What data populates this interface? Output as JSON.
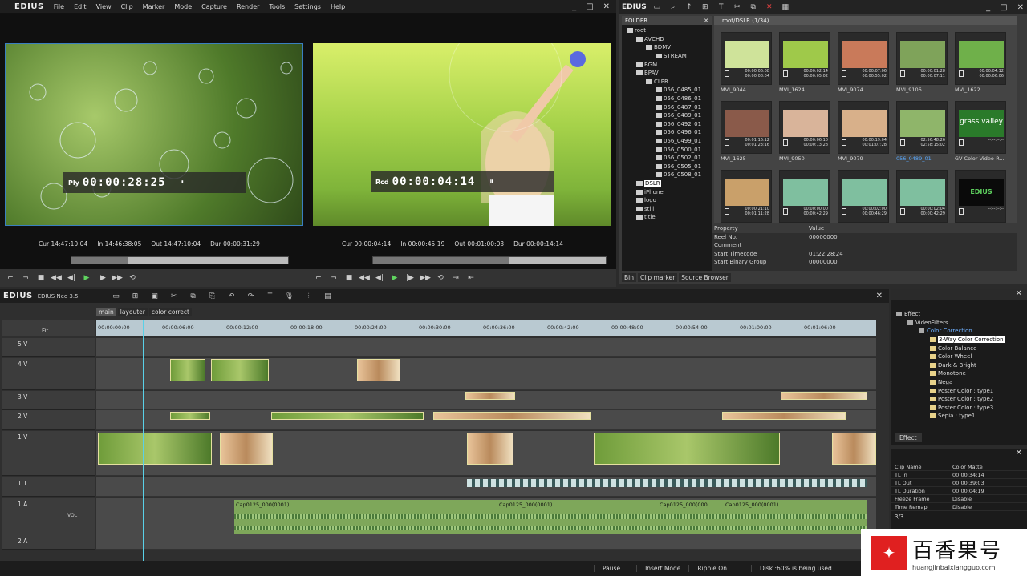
{
  "app": {
    "logo": "EDIUS",
    "menu": [
      "File",
      "Edit",
      "View",
      "Clip",
      "Marker",
      "Mode",
      "Capture",
      "Render",
      "Tools",
      "Settings",
      "Help"
    ],
    "win_controls": [
      "_",
      "□",
      "✕"
    ]
  },
  "player": {
    "mode": "Ply",
    "timecode": "00:00:28:25",
    "cur_label": "Cur",
    "cur": "14:47:10:04",
    "in_label": "In",
    "in": "14:46:38:05",
    "out_label": "Out",
    "out": "14:47:10:04",
    "dur_label": "Dur",
    "dur": "00:00:31:29"
  },
  "recorder": {
    "mode": "Rcd",
    "timecode": "00:00:04:14",
    "cur_label": "Cur",
    "cur": "00:00:04:14",
    "in_label": "In",
    "in": "00:00:45:19",
    "out_label": "Out",
    "out": "00:01:00:03",
    "dur_label": "Dur",
    "dur": "00:00:14:14"
  },
  "bin": {
    "title": "EDIUS",
    "folder_header": "FOLDER",
    "path": "root/DSLR (1/34)",
    "tree": [
      {
        "label": "root",
        "indent": 0
      },
      {
        "label": "AVCHD",
        "indent": 1
      },
      {
        "label": "BDMV",
        "indent": 2
      },
      {
        "label": "STREAM",
        "indent": 3
      },
      {
        "label": "BGM",
        "indent": 1
      },
      {
        "label": "BPAV",
        "indent": 1
      },
      {
        "label": "CLPR",
        "indent": 2
      },
      {
        "label": "056_0485_01",
        "indent": 3
      },
      {
        "label": "056_0486_01",
        "indent": 3
      },
      {
        "label": "056_0487_01",
        "indent": 3
      },
      {
        "label": "056_0489_01",
        "indent": 3
      },
      {
        "label": "056_0492_01",
        "indent": 3
      },
      {
        "label": "056_0496_01",
        "indent": 3
      },
      {
        "label": "056_0499_01",
        "indent": 3
      },
      {
        "label": "056_0500_01",
        "indent": 3
      },
      {
        "label": "056_0502_01",
        "indent": 3
      },
      {
        "label": "056_0505_01",
        "indent": 3
      },
      {
        "label": "056_0508_01",
        "indent": 3
      },
      {
        "label": "DSLR",
        "indent": 1,
        "selected": true
      },
      {
        "label": "iPhone",
        "indent": 1
      },
      {
        "label": "logo",
        "indent": 1
      },
      {
        "label": "still",
        "indent": 1
      },
      {
        "label": "title",
        "indent": 1
      }
    ],
    "clips": [
      {
        "name": "MVI_9044",
        "tc1": "00:00:06:08",
        "tc2": "00:00:08:04",
        "color": "#cfe39a"
      },
      {
        "name": "MVI_1624",
        "tc1": "00:00:02:14",
        "tc2": "00:00:05:02",
        "color": "#9fc94a"
      },
      {
        "name": "MVI_9074",
        "tc1": "00:00:07:06",
        "tc2": "00:00:55:02",
        "color": "#c97a5a"
      },
      {
        "name": "MVI_9106",
        "tc1": "00:00:01:28",
        "tc2": "00:00:07:11",
        "color": "#7fa35a"
      },
      {
        "name": "MVI_1622",
        "tc1": "00:00:04:12",
        "tc2": "00:00:06:06",
        "color": "#6fb04a"
      },
      {
        "name": "MVI_1625",
        "tc1": "00:01:16:12",
        "tc2": "00:01:23:16",
        "color": "#8a5a4a"
      },
      {
        "name": "MVI_9050",
        "tc1": "00:00:06:10",
        "tc2": "00:00:13:28",
        "color": "#d9b49a"
      },
      {
        "name": "MVI_9079",
        "tc1": "00:00:19:04",
        "tc2": "00:01:07:28",
        "color": "#d8b08a"
      },
      {
        "name": "056_0489_01",
        "tc1": "02:56:48:26",
        "tc2": "02:58:15:02",
        "color": "#8fb56a"
      },
      {
        "name": "GV Color Video-R...",
        "tc1": "--:--:--:--",
        "tc2": "",
        "color": "#2a7a2a"
      },
      {
        "name": "",
        "tc1": "00:00:21:10",
        "tc2": "00:01:11:28",
        "color": "#c9a06a"
      },
      {
        "name": "",
        "tc1": "00:00:00:00",
        "tc2": "00:00:42:29",
        "color": "#7fbf9f"
      },
      {
        "name": "",
        "tc1": "00:00:02:00",
        "tc2": "00:00:46:29",
        "color": "#7fbf9f"
      },
      {
        "name": "",
        "tc1": "00:00:02:04",
        "tc2": "00:00:42:29",
        "color": "#7fbf9f"
      },
      {
        "name": "EDIUS",
        "tc1": "--:--:--:--",
        "tc2": "",
        "color": "#0a0a0a"
      }
    ],
    "gv_logo": "grass valley",
    "prop_headers": [
      "Property",
      "Value"
    ],
    "props": [
      [
        "Reel No.",
        "00000000"
      ],
      [
        "Comment",
        ""
      ],
      [
        "Start Timecode",
        "01:22:28:24"
      ],
      [
        "Start Binary Group",
        "00000000"
      ]
    ],
    "tabs": [
      "Bin",
      "Clip marker",
      "Source Browser"
    ]
  },
  "timeline": {
    "logo": "EDIUS",
    "edition": "EDIUS Neo 3.5",
    "sequences": [
      "main",
      "layouter",
      "color correct"
    ],
    "fit": "Fit",
    "ruler": [
      "00:00:00:00",
      "00:00:06:00",
      "00:00:12:00",
      "00:00:18:00",
      "00:00:24:00",
      "00:00:30:00",
      "00:00:36:00",
      "00:00:42:00",
      "00:00:48:00",
      "00:00:54:00",
      "00:01:00:00",
      "00:01:06:00"
    ],
    "tracks": [
      "5 V",
      "4 V",
      "3 V",
      "2 V",
      "1 V",
      "1 T",
      "1 A",
      "2 A"
    ],
    "audio_clips": [
      "Cap0125_000(0001)",
      "Cap0125_000(0001)",
      "Cap0125_000(000...",
      "Cap0125_000(0001)"
    ],
    "vol": "VOL"
  },
  "effects": {
    "tree": [
      {
        "label": "Effect",
        "indent": 0
      },
      {
        "label": "VideoFilters",
        "indent": 1
      },
      {
        "label": "Color Correction",
        "indent": 2,
        "accent": true
      },
      {
        "label": "3-Way Color Correction",
        "indent": 3,
        "selected": true
      },
      {
        "label": "Color Balance",
        "indent": 3
      },
      {
        "label": "Color Wheel",
        "indent": 3
      },
      {
        "label": "Dark & Bright",
        "indent": 3
      },
      {
        "label": "Monotone",
        "indent": 3
      },
      {
        "label": "Nega",
        "indent": 3
      },
      {
        "label": "Poster Color : type1",
        "indent": 3
      },
      {
        "label": "Poster Color : type2",
        "indent": 3
      },
      {
        "label": "Poster Color : type3",
        "indent": 3
      },
      {
        "label": "Sepia : type1",
        "indent": 3
      }
    ],
    "tab": "Effect"
  },
  "clipinfo": {
    "rows": [
      [
        "Clip Name",
        "Color Matte"
      ],
      [
        "TL In",
        "00:00:34:14"
      ],
      [
        "TL Out",
        "00:00:39:03"
      ],
      [
        "TL Duration",
        "00:00:04:19"
      ],
      [
        "Freeze Frame",
        "Disable"
      ],
      [
        "Time Remap",
        "Disable"
      ]
    ],
    "page": "3/3"
  },
  "status": {
    "items": [
      "Pause",
      "Insert Mode",
      "Ripple On",
      "Disk :60% is being used"
    ]
  },
  "watermark": {
    "cn": "百香果号",
    "url": "huangjinbaixiangguo.com"
  }
}
